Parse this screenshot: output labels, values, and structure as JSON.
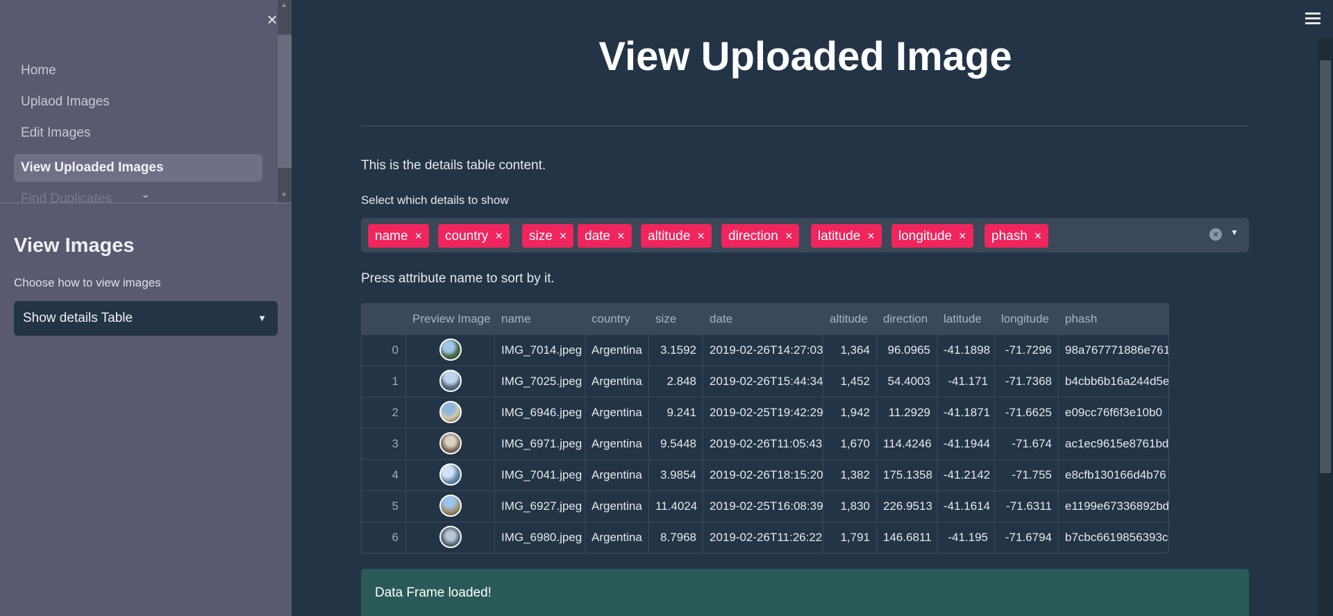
{
  "sidebar": {
    "nav": [
      {
        "label": "Home"
      },
      {
        "label": "Uplaod Images"
      },
      {
        "label": "Edit Images"
      },
      {
        "label": "View Uploaded Images"
      },
      {
        "label": "Find Duplicates"
      }
    ],
    "active_index": 3,
    "heading": "View Images",
    "view_label": "Choose how to view images",
    "view_select_value": "Show details Table"
  },
  "main": {
    "title": "View Uploaded Image",
    "intro": "This is the details table content.",
    "select_label": "Select which details to show",
    "selected_tags": [
      "name",
      "country",
      "size",
      "date",
      "altitude",
      "direction",
      "latitude",
      "longitude",
      "phash"
    ],
    "sort_hint": "Press attribute name to sort by it.",
    "table": {
      "columns": [
        "",
        "Preview Image",
        "name",
        "country",
        "size",
        "date",
        "altitude",
        "direction",
        "latitude",
        "longitude",
        "phash"
      ],
      "rows": [
        {
          "idx": "0",
          "name": "IMG_7014.jpeg",
          "country": "Argentina",
          "size": "3.1592",
          "date": "2019-02-26T14:27:03",
          "altitude": "1,364",
          "direction": "96.0965",
          "latitude": "-41.1898",
          "longitude": "-71.7296",
          "phash": "98a767771886e761"
        },
        {
          "idx": "1",
          "name": "IMG_7025.jpeg",
          "country": "Argentina",
          "size": "2.848",
          "date": "2019-02-26T15:44:34",
          "altitude": "1,452",
          "direction": "54.4003",
          "latitude": "-41.171",
          "longitude": "-71.7368",
          "phash": "b4cbb6b16a244d5e"
        },
        {
          "idx": "2",
          "name": "IMG_6946.jpeg",
          "country": "Argentina",
          "size": "9.241",
          "date": "2019-02-25T19:42:29",
          "altitude": "1,942",
          "direction": "11.2929",
          "latitude": "-41.1871",
          "longitude": "-71.6625",
          "phash": "e09cc76f6f3e10b0"
        },
        {
          "idx": "3",
          "name": "IMG_6971.jpeg",
          "country": "Argentina",
          "size": "9.5448",
          "date": "2019-02-26T11:05:43",
          "altitude": "1,670",
          "direction": "114.4246",
          "latitude": "-41.1944",
          "longitude": "-71.674",
          "phash": "ac1ec9615e8761bd"
        },
        {
          "idx": "4",
          "name": "IMG_7041.jpeg",
          "country": "Argentina",
          "size": "3.9854",
          "date": "2019-02-26T18:15:20",
          "altitude": "1,382",
          "direction": "175.1358",
          "latitude": "-41.2142",
          "longitude": "-71.755",
          "phash": "e8cfb130166d4b76"
        },
        {
          "idx": "5",
          "name": "IMG_6927.jpeg",
          "country": "Argentina",
          "size": "11.4024",
          "date": "2019-02-25T16:08:39",
          "altitude": "1,830",
          "direction": "226.9513",
          "latitude": "-41.1614",
          "longitude": "-71.6311",
          "phash": "e1199e67336892bd"
        },
        {
          "idx": "6",
          "name": "IMG_6980.jpeg",
          "country": "Argentina",
          "size": "8.7968",
          "date": "2019-02-26T11:26:22",
          "altitude": "1,791",
          "direction": "146.6811",
          "latitude": "-41.195",
          "longitude": "-71.6794",
          "phash": "b7cbc6619856393c"
        }
      ]
    },
    "success_message": "Data Frame loaded!"
  },
  "icons": {
    "close": "close-icon",
    "menu": "hamburger-menu-icon",
    "tag_remove": "tag-remove-icon",
    "clear": "clear-all-icon",
    "dropdown": "chevron-down-icon"
  },
  "colors": {
    "tag": "#f0255d",
    "main_bg": "#243447",
    "sidebar_bg": "#595a70",
    "success_bg": "#2a5a57"
  }
}
